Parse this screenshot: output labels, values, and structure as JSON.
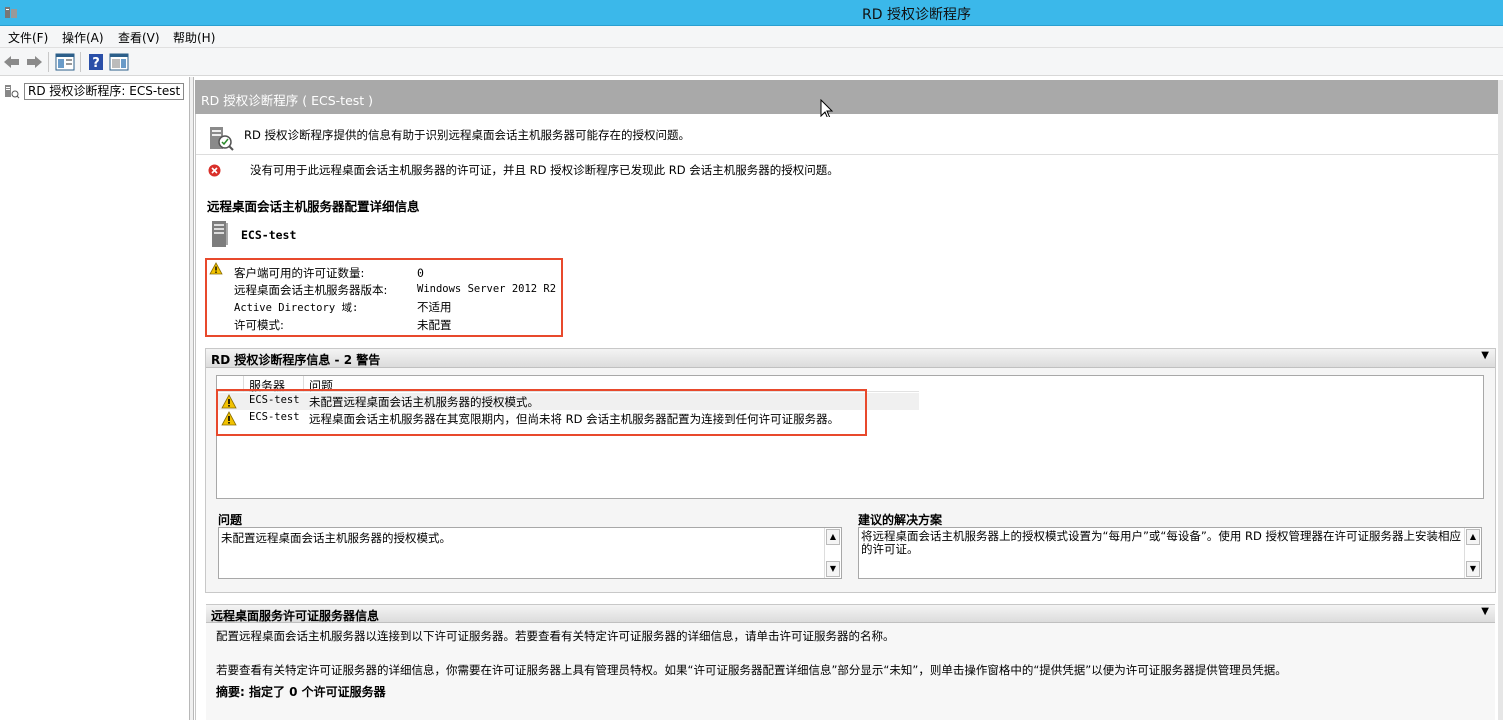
{
  "window": {
    "title": "RD 授权诊断程序"
  },
  "menu": {
    "file": "文件(F)",
    "action": "操作(A)",
    "view": "查看(V)",
    "help": "帮助(H)"
  },
  "toolbar": {
    "back": "back-icon",
    "forward": "forward-icon",
    "show_hide_tree": "console-tree-icon",
    "help": "help-icon",
    "action_pane": "action-pane-icon"
  },
  "tree": {
    "root_label": "RD 授权诊断程序: ECS-test"
  },
  "main": {
    "header_title": "RD 授权诊断程序 ( ECS-test )",
    "info_text": "RD 授权诊断程序提供的信息有助于识别远程桌面会话主机服务器可能存在的授权问题。",
    "error_text": "没有可用于此远程桌面会话主机服务器的许可证，并且 RD 授权诊断程序已发现此 RD 会话主机服务器的授权问题。",
    "config_title": "远程桌面会话主机服务器配置详细信息",
    "server_name": "ECS-test",
    "details": [
      {
        "label": "客户端可用的许可证数量:",
        "value": "0"
      },
      {
        "label": "远程桌面会话主机服务器版本:",
        "value": "Windows Server 2012 R2"
      },
      {
        "label": "Active Directory 域:",
        "value": "不适用"
      },
      {
        "label": "许可模式:",
        "value": "未配置"
      }
    ]
  },
  "diag": {
    "title": "RD 授权诊断程序信息 - 2 警告",
    "col_server": "服务器",
    "col_issue": "问题",
    "rows": [
      {
        "server": "ECS-test",
        "issue": "未配置远程桌面会话主机服务器的授权模式。"
      },
      {
        "server": "ECS-test",
        "issue": "远程桌面会话主机服务器在其宽限期内，但尚未将 RD 会话主机服务器配置为连接到任何许可证服务器。"
      }
    ],
    "problem_label": "问题",
    "problem_text": "未配置远程桌面会话主机服务器的授权模式。",
    "solution_label": "建议的解决方案",
    "solution_text": "将远程桌面会话主机服务器上的授权模式设置为“每用户”或“每设备”。使用 RD 授权管理器在许可证服务器上安装相应的许可证。"
  },
  "license": {
    "title": "远程桌面服务许可证服务器信息",
    "line1": "配置远程桌面会话主机服务器以连接到以下许可证服务器。若要查看有关特定许可证服务器的详细信息，请单击许可证服务器的名称。",
    "line2": "若要查看有关特定许可证服务器的详细信息，你需要在许可证服务器上具有管理员特权。如果“许可证服务器配置详细信息”部分显示“未知”，则单击操作窗格中的“提供凭据”以便为许可证服务器提供管理员凭据。",
    "summary": "摘要: 指定了 0 个许可证服务器"
  },
  "colors": {
    "titlebar": "#3bb8ea",
    "highlight_border": "#e8492c",
    "header_gray": "#a9a9a9"
  }
}
